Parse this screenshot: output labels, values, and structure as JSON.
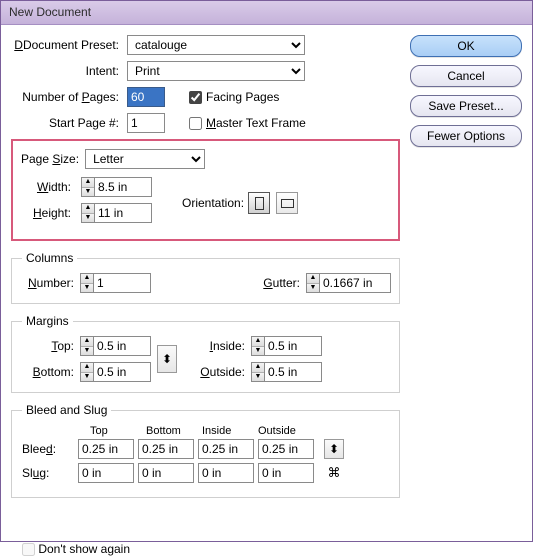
{
  "window": {
    "title": "New Document"
  },
  "buttons": {
    "ok": "OK",
    "cancel": "Cancel",
    "save_preset": "Save Preset...",
    "fewer_options": "Fewer Options"
  },
  "preset": {
    "label": "Document Preset:",
    "value": "catalouge"
  },
  "intent": {
    "label": "Intent:",
    "value": "Print"
  },
  "pages": {
    "number_label_pre": "Number of ",
    "number_label_u": "P",
    "number_label_post": "ages:",
    "number_value": "60",
    "start_label": "Start Page #:",
    "start_value": "1",
    "facing_label": "Facing Pages",
    "facing_checked": true,
    "master_label_u": "M",
    "master_label_post": "aster Text Frame",
    "master_checked": false
  },
  "page_size": {
    "label_pre": "Page ",
    "label_u": "S",
    "label_post": "ize:",
    "value": "Letter",
    "width_label_u": "W",
    "width_label_post": "idth:",
    "width_value": "8.5 in",
    "height_label_u": "H",
    "height_label_post": "eight:",
    "height_value": "11 in",
    "orientation_label": "Orientation:"
  },
  "columns": {
    "legend": "Columns",
    "number_label_u": "N",
    "number_label_post": "umber:",
    "number_value": "1",
    "gutter_label_u": "G",
    "gutter_label_post": "utter:",
    "gutter_value": "0.1667 in"
  },
  "margins": {
    "legend": "Margins",
    "top_label_u": "T",
    "top_label_post": "op:",
    "top_value": "0.5 in",
    "bottom_label_u": "B",
    "bottom_label_post": "ottom:",
    "bottom_value": "0.5 in",
    "inside_label_u": "I",
    "inside_label_post": "nside:",
    "inside_value": "0.5 in",
    "outside_label_u": "O",
    "outside_label_post": "utside:",
    "outside_value": "0.5 in"
  },
  "bleed_slug": {
    "legend": "Bleed and Slug",
    "hdr_top": "Top",
    "hdr_bottom": "Bottom",
    "hdr_inside": "Inside",
    "hdr_outside": "Outside",
    "bleed_label_pre": "Blee",
    "bleed_label_u": "d",
    "bleed_label_post": ":",
    "bleed": {
      "top": "0.25 in",
      "bottom": "0.25 in",
      "inside": "0.25 in",
      "outside": "0.25 in"
    },
    "slug_label_pre": "Sl",
    "slug_label_u": "u",
    "slug_label_post": "g:",
    "slug": {
      "top": "0 in",
      "bottom": "0 in",
      "inside": "0 in",
      "outside": "0 in"
    }
  },
  "footer_fragment": "Don't show again"
}
